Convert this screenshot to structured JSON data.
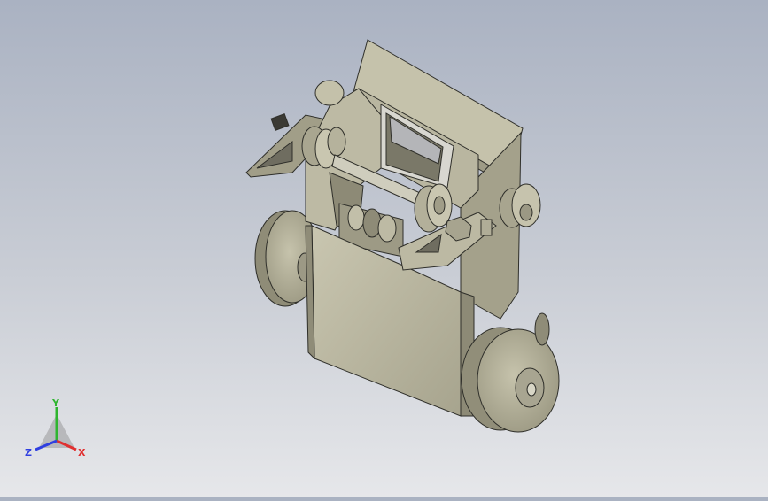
{
  "viewport": {
    "background_top": "#aab2c2",
    "background_bottom": "#e6e7ea",
    "part_color": "#b8b59f",
    "edge_color": "#2f2f2a"
  },
  "triad": {
    "x_label": "X",
    "y_label": "Y",
    "z_label": "Z",
    "x_color": "#e03030",
    "y_color": "#2fb52f",
    "z_color": "#2f3fe0"
  }
}
